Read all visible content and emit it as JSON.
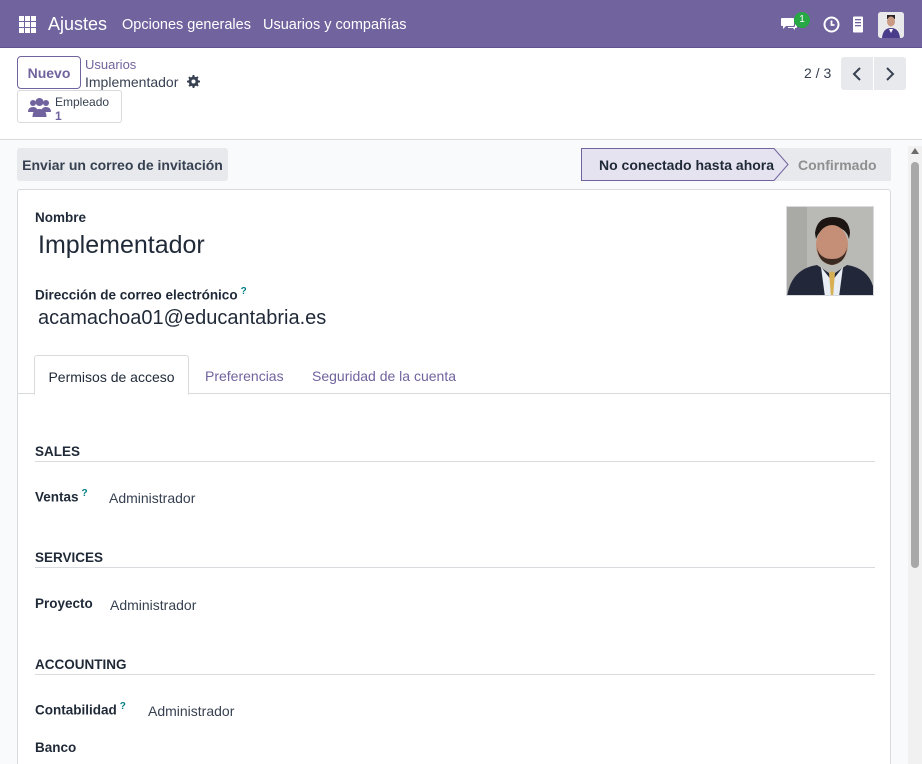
{
  "navbar": {
    "brand": "Ajustes",
    "menu": [
      "Opciones generales",
      "Usuarios y compañías"
    ],
    "chat_badge": "1",
    "icons": [
      "apps-grid-icon",
      "chat-icon",
      "clock-icon",
      "phone-icon",
      "user-avatar"
    ]
  },
  "control": {
    "new_label": "Nuevo",
    "breadcrumb_parent": "Usuarios",
    "breadcrumb_current": "Implementador",
    "smart_button_label": "Empleado",
    "smart_button_count": "1",
    "pager": "2 / 3"
  },
  "form": {
    "invite_label": "Enviar un correo de invitación",
    "status_active": "No conectado hasta ahora",
    "status_next": "Confirmado",
    "name_label": "Nombre",
    "name_value": "Implementador",
    "email_label": "Dirección de correo electrónico",
    "help_mark": "?",
    "email_value": "acamachoa01@educantabria.es",
    "tabs": [
      "Permisos de acceso",
      "Preferencias",
      "Seguridad de la cuenta"
    ],
    "sections": [
      {
        "title": "SALES",
        "field": "Ventas",
        "value": "Administrador"
      },
      {
        "title": "SERVICES",
        "field": "Proyecto",
        "value": "Administrador"
      },
      {
        "title": "ACCOUNTING",
        "field": "Contabilidad",
        "value": "Administrador"
      }
    ],
    "extra_field": "Banco"
  },
  "colors": {
    "primary": "#71639e",
    "success_badge": "#28a745",
    "help": "#017e84"
  }
}
